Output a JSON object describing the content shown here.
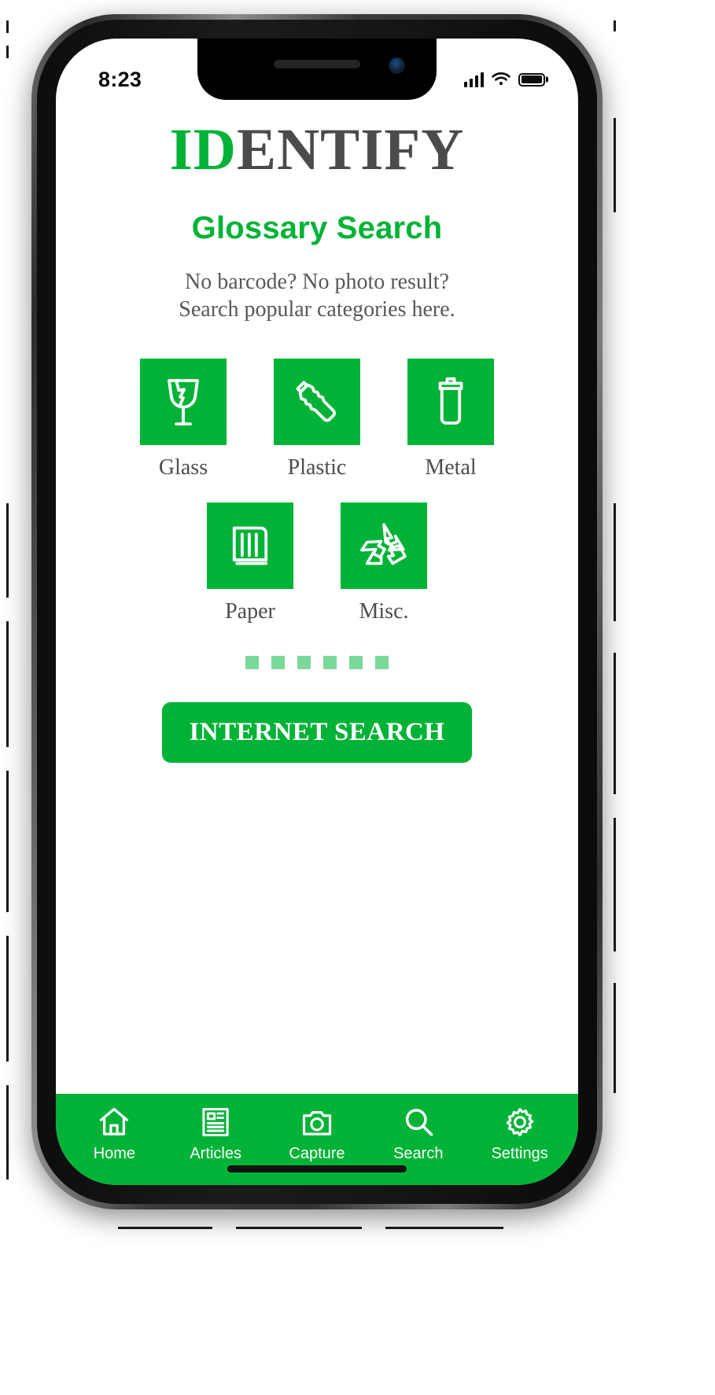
{
  "status_bar": {
    "time": "8:23",
    "signal_icon": "cellular-signal-icon",
    "wifi_icon": "wifi-icon",
    "battery_icon": "battery-full-icon"
  },
  "brand": {
    "highlight": "ID",
    "rest": "ENTIFY",
    "highlight_color": "#00B336",
    "rest_color": "#4b4b4b"
  },
  "header": {
    "section_title": "Glossary Search",
    "lede_line1": "No barcode? No photo result?",
    "lede_line2": "Search popular categories here."
  },
  "categories": [
    {
      "label": "Glass",
      "icon": "broken-glass-icon"
    },
    {
      "label": "Plastic",
      "icon": "plastic-bottle-icon"
    },
    {
      "label": "Metal",
      "icon": "metal-can-icon"
    },
    {
      "label": "Paper",
      "icon": "book-icon"
    },
    {
      "label": "Misc.",
      "icon": "recycling-icon"
    }
  ],
  "pager": {
    "count": 6,
    "dot_color": "#79d89a"
  },
  "cta": {
    "label": "INTERNET SEARCH",
    "background": "#00B336",
    "text_color": "#ffffff"
  },
  "tabbar": {
    "background": "#00B336",
    "items": [
      {
        "label": "Home",
        "icon": "home-icon"
      },
      {
        "label": "Articles",
        "icon": "articles-icon"
      },
      {
        "label": "Capture",
        "icon": "camera-icon"
      },
      {
        "label": "Search",
        "icon": "search-icon"
      },
      {
        "label": "Settings",
        "icon": "gear-icon"
      }
    ]
  }
}
